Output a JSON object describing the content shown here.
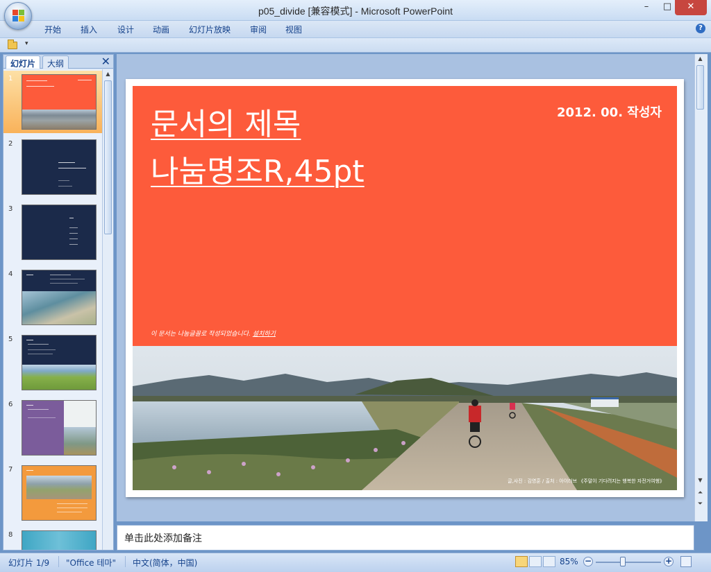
{
  "window": {
    "title": "p05_divide [兼容模式] - Microsoft PowerPoint",
    "minimize": "–",
    "maximize": "□",
    "close": "✕"
  },
  "ribbon_tabs": [
    "开始",
    "插入",
    "设计",
    "动画",
    "幻灯片放映",
    "审阅",
    "视图"
  ],
  "help": "?",
  "qat": {
    "more": "▾"
  },
  "left_pane": {
    "tab_slides": "幻灯片",
    "tab_outline": "大纲",
    "close": "✕",
    "thumbnails": [
      "1",
      "2",
      "3",
      "4",
      "5",
      "6",
      "7",
      "8"
    ],
    "selected": "1"
  },
  "slide": {
    "title_line1": "문서의 제목",
    "title_line2": "나눔명조R,45pt",
    "date_author": "2012. 00. 작성자",
    "note_text": "이 문서는 나눔글꼴로 작성되었습니다. ",
    "note_link": "설치하기",
    "photo_credit": "글,사진 : 김영훈 / 출처 : 아이러브 《주말이 기다려지는 행복한 자전거여행》",
    "colors": {
      "accent": "#fd5b3b",
      "dark_navy": "#1b2a4a",
      "purple": "#7b5c9b",
      "orange": "#f39a3d"
    }
  },
  "notes": {
    "placeholder": "单击此处添加备注"
  },
  "status_bar": {
    "slide_pos": "幻灯片 1/9",
    "theme": "\"Office 테마\"",
    "language": "中文(简体，中国)",
    "zoom": "85%",
    "zoom_out": "−",
    "zoom_in": "+"
  }
}
